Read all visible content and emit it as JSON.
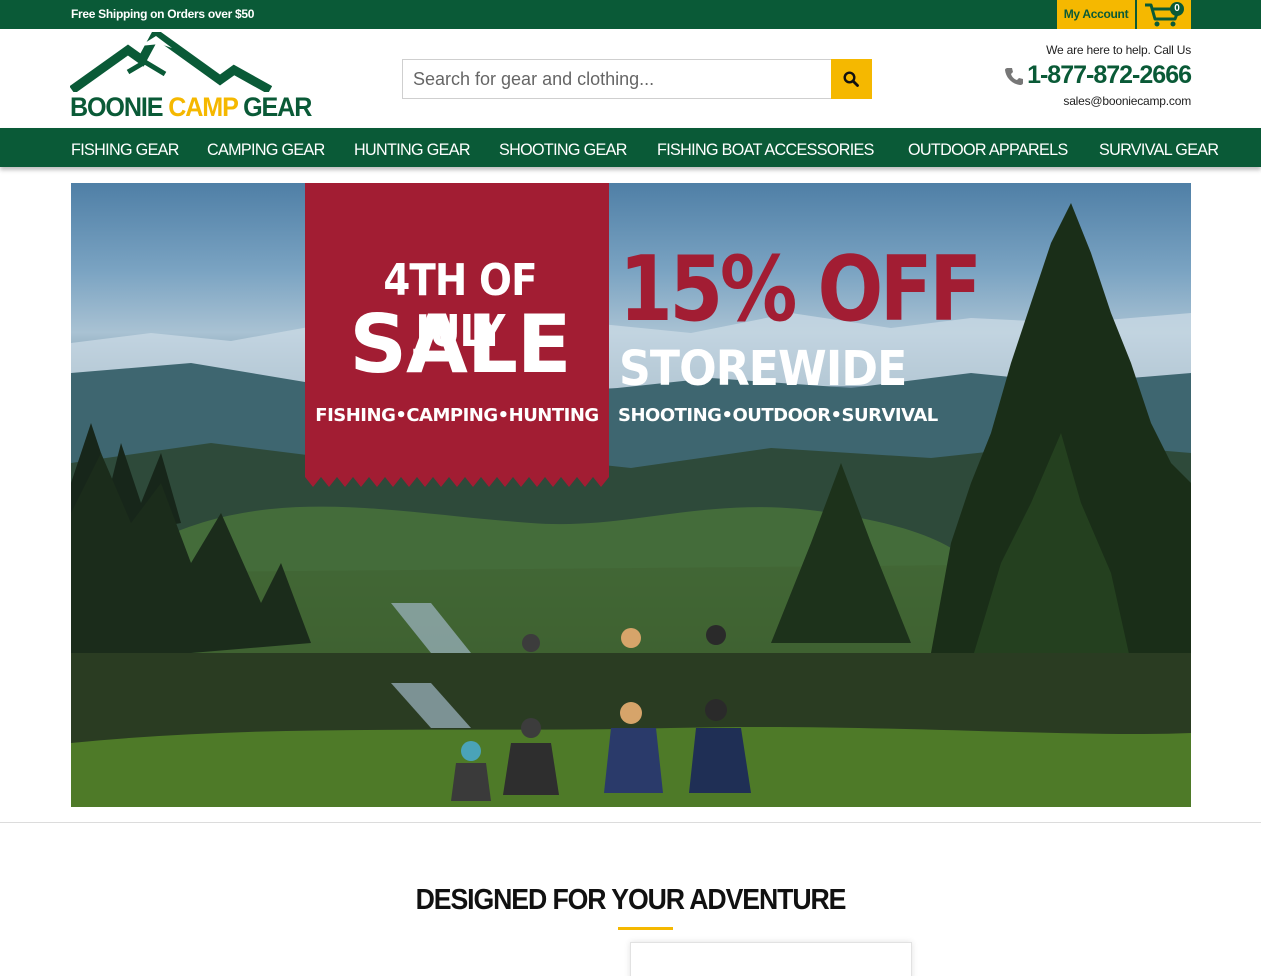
{
  "topbar": {
    "shipping_text": "Free Shipping on Orders over $50",
    "account_label": "My Account",
    "cart_count": "0"
  },
  "header": {
    "logo": {
      "word1": "BOONIE",
      "word2": "CAMP",
      "word3": "GEAR"
    },
    "search_placeholder": "Search for gear and clothing...",
    "help_text": "We are here to help. Call Us",
    "phone": "1-877-872-2666",
    "email": "sales@booniecamp.com"
  },
  "nav": {
    "items": [
      "FISHING GEAR",
      "CAMPING GEAR",
      "HUNTING GEAR",
      "SHOOTING GEAR",
      "FISHING BOAT ACCESSORIES",
      "OUTDOOR APPARELS",
      "SURVIVAL GEAR"
    ]
  },
  "hero": {
    "line1": "4TH OF JULY",
    "line2": "SALE",
    "line3": "FISHING•CAMPING•HUNTING",
    "discount": "15% OFF",
    "storewide": "STOREWIDE",
    "line4": "SHOOTING•OUTDOOR•SURVIVAL"
  },
  "section": {
    "title": "DESIGNED FOR YOUR ADVENTURE"
  },
  "colors": {
    "brand_green": "#0a5a37",
    "accent_yellow": "#f5b800",
    "banner_red": "#a21d33"
  }
}
